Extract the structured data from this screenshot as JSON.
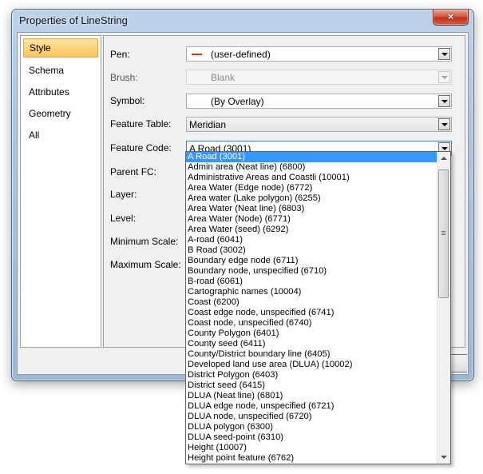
{
  "window": {
    "title": "Properties of LineString",
    "close_glyph": "×"
  },
  "sidebar": {
    "items": [
      "Style",
      "Schema",
      "Attributes",
      "Geometry",
      "All"
    ],
    "active": "Style"
  },
  "form": {
    "pen": {
      "label": "Pen:",
      "value": "(user-defined)",
      "swatch_color": "#c0392b"
    },
    "brush": {
      "label": "Brush:",
      "value": "Blank"
    },
    "symbol": {
      "label": "Symbol:",
      "value": "(By Overlay)"
    },
    "feature_table": {
      "label": "Feature Table:",
      "value": "Meridian"
    },
    "feature_code": {
      "label": "Feature Code:",
      "value": "A Road (3001)"
    },
    "parent_fc": {
      "label": "Parent FC:"
    },
    "layer": {
      "label": "Layer:"
    },
    "level": {
      "label": "Level:"
    },
    "min_scale": {
      "label": "Minimum Scale:"
    },
    "max_scale": {
      "label": "Maximum Scale:"
    }
  },
  "dropdown": {
    "selected_index": 0,
    "selection_color": "#3399ff",
    "items": [
      "A Road (3001)",
      "Admin area (Neat line) (6800)",
      "Administrative Areas and Coastli (10001)",
      "Area Water (Edge node) (6772)",
      "Area water (Lake polygon) (6255)",
      "Area Water (Neat line) (6803)",
      "Area Water (Node) (6771)",
      "Area Water (seed) (6292)",
      "A-road (6041)",
      "B Road (3002)",
      "Boundary edge node (6711)",
      "Boundary node, unspecified (6710)",
      "B-road (6061)",
      "Cartographic names (10004)",
      "Coast (6200)",
      "Coast edge node, unspecified (6741)",
      "Coast node, unspecified (6740)",
      "County Polygon (6401)",
      "County seed (6411)",
      "County/District boundary line (6405)",
      "Developed land use area (DLUA) (10002)",
      "District Polygon (6403)",
      "District seed (6415)",
      "DLUA (Neat line) (6801)",
      "DLUA edge node, unspecified (6721)",
      "DLUA node, unspecified (6720)",
      "DLUA polygon (6300)",
      "DLUA seed-point (6310)",
      "Height (10007)",
      "Height point feature (6762)"
    ]
  }
}
